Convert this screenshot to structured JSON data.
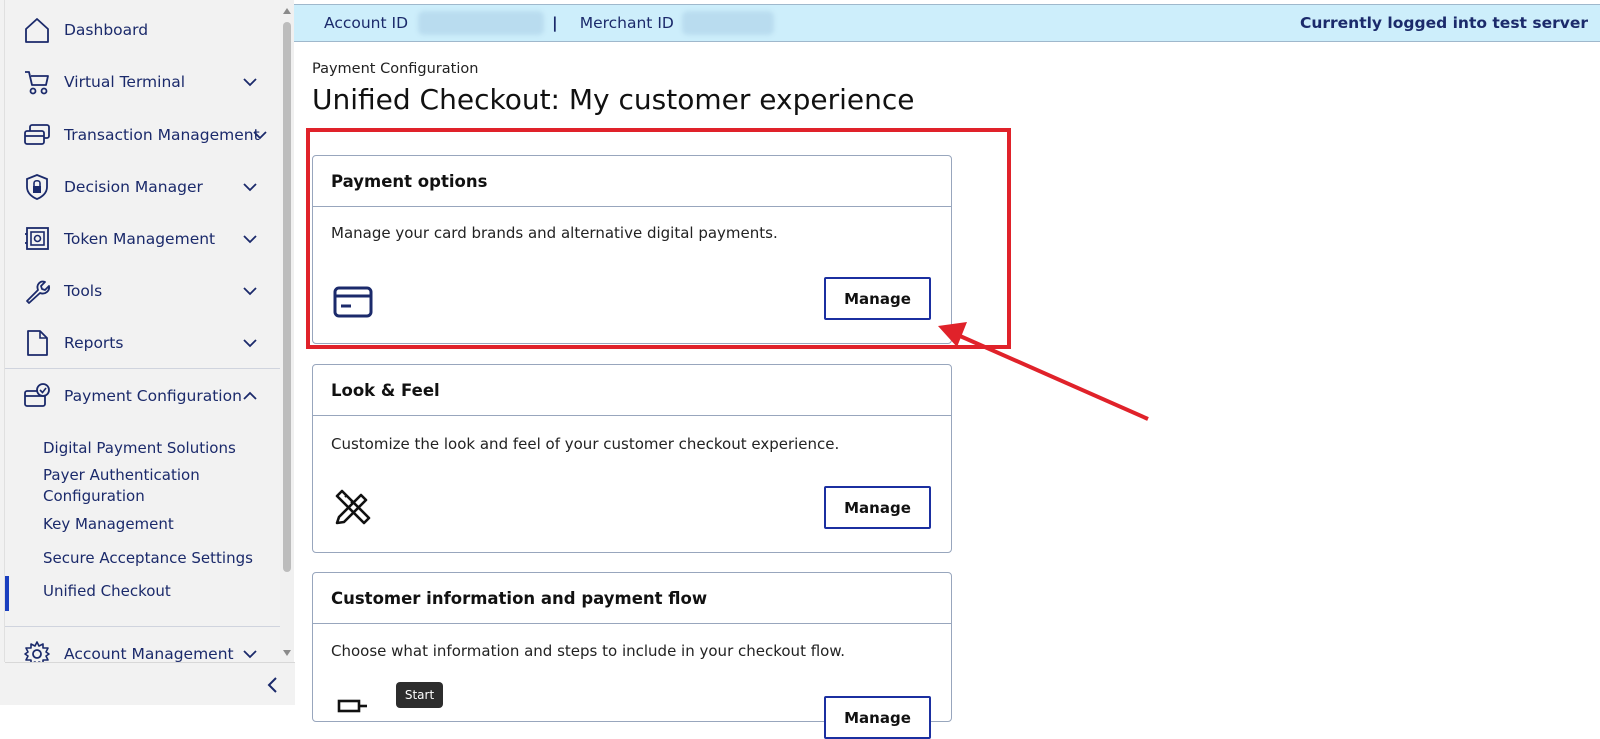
{
  "sidebar": {
    "items": [
      {
        "label": "Dashboard",
        "icon": "home-icon"
      },
      {
        "label": "Virtual Terminal",
        "icon": "cart-icon"
      },
      {
        "label": "Transaction Management",
        "icon": "cards-icon"
      },
      {
        "label": "Decision Manager",
        "icon": "shield-lock-icon"
      },
      {
        "label": "Token Management",
        "icon": "vault-icon"
      },
      {
        "label": "Tools",
        "icon": "wrench-icon"
      },
      {
        "label": "Reports",
        "icon": "document-icon"
      },
      {
        "label": "Payment Configuration",
        "icon": "card-check-icon"
      },
      {
        "label": "Account Management",
        "icon": "gear-icon"
      }
    ],
    "subitems": [
      "Digital Payment Solutions",
      "Payer Authentication Configuration",
      "Key Management",
      "Secure Acceptance Settings",
      "Unified Checkout"
    ],
    "active_subitem": "Unified Checkout"
  },
  "topbar": {
    "account_id_label": "Account ID",
    "separator": "|",
    "merchant_id_label": "Merchant ID",
    "status": "Currently logged into test server"
  },
  "main": {
    "breadcrumb": "Payment Configuration",
    "title": "Unified Checkout: My customer experience",
    "cards": [
      {
        "title": "Payment options",
        "description": "Manage your card brands and alternative digital payments.",
        "button": "Manage",
        "icon": "credit-card-icon"
      },
      {
        "title": "Look & Feel",
        "description": "Customize the look and feel of your customer checkout experience.",
        "button": "Manage",
        "icon": "design-tools-icon"
      },
      {
        "title": "Customer information and payment flow",
        "description": "Choose what information and steps to include in your checkout flow.",
        "button": "Manage",
        "icon": "flow-icon"
      }
    ]
  },
  "tooltip": "Start",
  "colors": {
    "accent": "#1b2fa0",
    "nav_text": "#1b2a6b",
    "topbar_bg": "#cdeefb",
    "annotation": "#e0222a"
  }
}
